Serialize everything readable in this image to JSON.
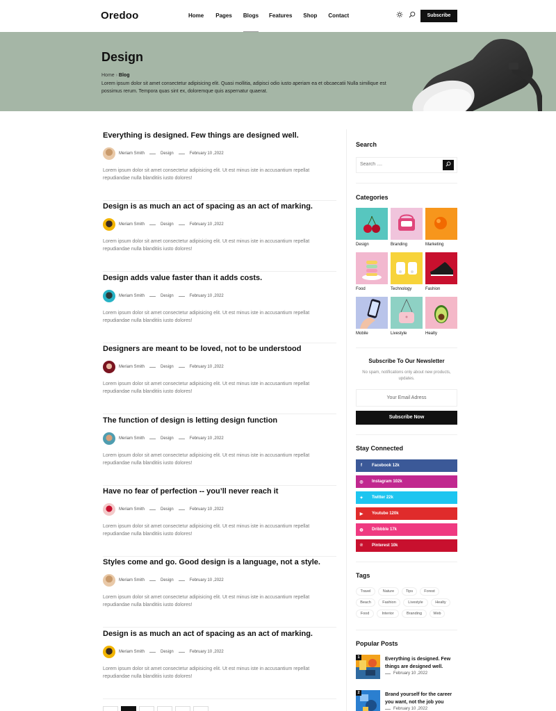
{
  "header": {
    "logo": "Oredoo",
    "nav": [
      "Home",
      "Pages",
      "Blogs",
      "Features",
      "Shop",
      "Contact"
    ],
    "active_nav": "Blogs",
    "subscribe_label": "Subscribe"
  },
  "hero": {
    "title": "Design",
    "breadcrumb_home": "Home",
    "breadcrumb_current": "Blog",
    "description": "Lorem ipsum dolor sit amet consectetur adipisicing elit. Quasi mollitia, adipisci odio iusto aperiam ea et obcaecatii Nulla similique est possimus rerum. Tempora quas sint ex, doloremque quis aspernatur quaerat."
  },
  "posts": [
    {
      "title": "Everything is designed. Few things are designed well.",
      "author": "Meriam Smith",
      "category": "Design",
      "date": "February 10 ,2022",
      "excerpt": "Lorem ipsum dolor sit amet consectetur adipisicing elit. Ut est minus iste in accusantium repellat repudiandae nulla blanditiis iusto dolores!"
    },
    {
      "title": "Design is as much an act of spacing as an act of marking.",
      "author": "Meriam Smith",
      "category": "Design",
      "date": "February 10 ,2022",
      "excerpt": "Lorem ipsum dolor sit amet consectetur adipisicing elit. Ut est minus iste in accusantium repellat repudiandae nulla blanditiis iusto dolores!"
    },
    {
      "title": "Design adds value faster than it adds costs.",
      "author": "Meriam Smith",
      "category": "Design",
      "date": "February 10 ,2022",
      "excerpt": "Lorem ipsum dolor sit amet consectetur adipisicing elit. Ut est minus iste in accusantium repellat repudiandae nulla blanditiis iusto dolores!"
    },
    {
      "title": "Designers are meant to be loved, not to be understood",
      "author": "Meriam Smith",
      "category": "Design",
      "date": "February 10 ,2022",
      "excerpt": "Lorem ipsum dolor sit amet consectetur adipisicing elit. Ut est minus iste in accusantium repellat repudiandae nulla blanditiis iusto dolores!"
    },
    {
      "title": "The function of design is letting design function",
      "author": "Meriam Smith",
      "category": "Design",
      "date": "February 10 ,2022",
      "excerpt": "Lorem ipsum dolor sit amet consectetur adipisicing elit. Ut est minus iste in accusantium repellat repudiandae nulla blanditiis iusto dolores!"
    },
    {
      "title": "Have no fear of perfection -- you’ll never reach it",
      "author": "Meriam Smith",
      "category": "Design",
      "date": "February 10 ,2022",
      "excerpt": "Lorem ipsum dolor sit amet consectetur adipisicing elit. Ut est minus iste in accusantium repellat repudiandae nulla blanditiis iusto dolores!"
    },
    {
      "title": "Styles come and go. Good design is a language, not a style.",
      "author": "Meriam Smith",
      "category": "Design",
      "date": "February 10 ,2022",
      "excerpt": "Lorem ipsum dolor sit amet consectetur adipisicing elit. Ut est minus iste in accusantium repellat repudiandae nulla blanditiis iusto dolores!"
    },
    {
      "title": "Design is as much an act of spacing as an act of marking.",
      "author": "Meriam Smith",
      "category": "Design",
      "date": "February 10 ,2022",
      "excerpt": "Lorem ipsum dolor sit amet consectetur adipisicing elit. Ut est minus iste in accusantium repellat repudiandae nulla blanditiis iusto dolores!"
    }
  ],
  "sidebar": {
    "search_title": "Search",
    "search_placeholder": "Search ....",
    "categories_title": "Categories",
    "categories": [
      "Design",
      "Branding",
      "Marketing",
      "Food",
      "Technology",
      "Fashion",
      "Mobile",
      "Livestyle",
      "Healty"
    ],
    "category_colors": [
      "#57c6bf",
      "#f0c4dc",
      "#f7961c",
      "#f2b8cf",
      "#f7d33a",
      "#c8102e",
      "#b9c4ea",
      "#8ed1c4",
      "#f4b8c8"
    ],
    "newsletter_title": "Subscribe To Our Newsletter",
    "newsletter_desc": "No spam, notifications only about new products, updates.",
    "newsletter_placeholder": "Your Email Adress",
    "newsletter_button": "Subscribe Now",
    "stay_connected_title": "Stay Connected",
    "social": [
      {
        "label": "Facebook 12k",
        "icon": "facebook-icon",
        "color": "#3b5998"
      },
      {
        "label": "Instagram 102k",
        "icon": "instagram-icon",
        "color": "#c1288f"
      },
      {
        "label": "Twitter 22k",
        "icon": "twitter-icon",
        "color": "#1dc5f0"
      },
      {
        "label": "Youtube 120k",
        "icon": "youtube-icon",
        "color": "#e02b2b"
      },
      {
        "label": "Dribbble 17k",
        "icon": "dribbble-icon",
        "color": "#ef3a81"
      },
      {
        "label": "Pinterest 10k",
        "icon": "pinterest-icon",
        "color": "#c8102e"
      }
    ],
    "tags_title": "Tags",
    "tags": [
      "Travel",
      "Nature",
      "Tips",
      "Forest",
      "Beach",
      "Fashion",
      "Livestyle",
      "Healty",
      "Food",
      "Interior",
      "Branding",
      "Web"
    ],
    "popular_title": "Popular Posts",
    "popular": [
      {
        "num": "1",
        "title": "Everything is designed. Few things are designed well.",
        "date": "February 10 ,2022"
      },
      {
        "num": "2",
        "title": "Brand yourself for the career you want, not the job you",
        "date": "February 10 ,2022"
      }
    ]
  }
}
